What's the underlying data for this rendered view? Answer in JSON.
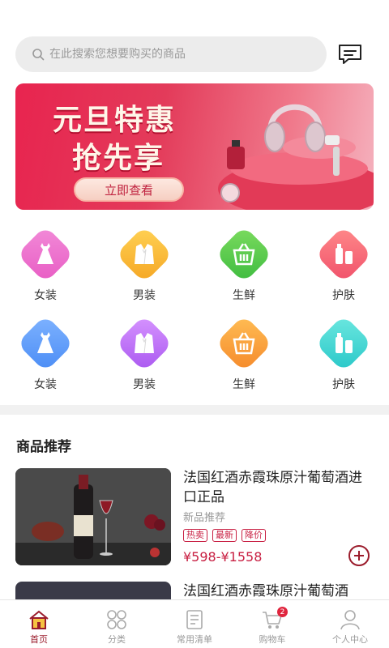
{
  "search": {
    "placeholder": "在此搜索您想要购买的商品"
  },
  "banner": {
    "title_line1": "元旦特惠",
    "title_line2": "抢先享",
    "cta_label": "立即查看"
  },
  "categories": [
    {
      "label": "女装",
      "icon": "dress-icon",
      "color_from": "#f28bd8",
      "color_to": "#e85cc4"
    },
    {
      "label": "男装",
      "icon": "suit-icon",
      "color_from": "#ffd255",
      "color_to": "#f5a623"
    },
    {
      "label": "生鲜",
      "icon": "basket-icon",
      "color_from": "#7ddc5f",
      "color_to": "#3dbb3f"
    },
    {
      "label": "护肤",
      "icon": "skincare-icon",
      "color_from": "#ff8a8a",
      "color_to": "#f0506a"
    },
    {
      "label": "女装",
      "icon": "dress-icon",
      "color_from": "#7fb3ff",
      "color_to": "#4a8cf5"
    },
    {
      "label": "男装",
      "icon": "suit-icon",
      "color_from": "#d795ff",
      "color_to": "#a957f0"
    },
    {
      "label": "生鲜",
      "icon": "basket-icon",
      "color_from": "#ffbe55",
      "color_to": "#f5892a"
    },
    {
      "label": "护肤",
      "icon": "skincare-icon",
      "color_from": "#6de8e0",
      "color_to": "#28c7c8"
    }
  ],
  "section": {
    "title": "商品推荐"
  },
  "products": [
    {
      "name": "法国红酒赤霞珠原汁葡萄酒进口正品",
      "subtitle": "新品推荐",
      "tags": [
        "热卖",
        "最新",
        "降价"
      ],
      "price": "¥598-¥1558"
    },
    {
      "name": "法国红酒赤霞珠原汁葡萄酒"
    }
  ],
  "tabbar": {
    "items": [
      {
        "label": "首页",
        "icon": "home-icon",
        "active": true
      },
      {
        "label": "分类",
        "icon": "category-icon",
        "active": false
      },
      {
        "label": "常用清单",
        "icon": "list-icon",
        "active": false
      },
      {
        "label": "购物车",
        "icon": "cart-icon",
        "active": false,
        "badge": "2"
      },
      {
        "label": "个人中心",
        "icon": "profile-icon",
        "active": false
      }
    ]
  },
  "colors": {
    "accent": "#c81f42",
    "tab_active": "#9b1c2c"
  }
}
